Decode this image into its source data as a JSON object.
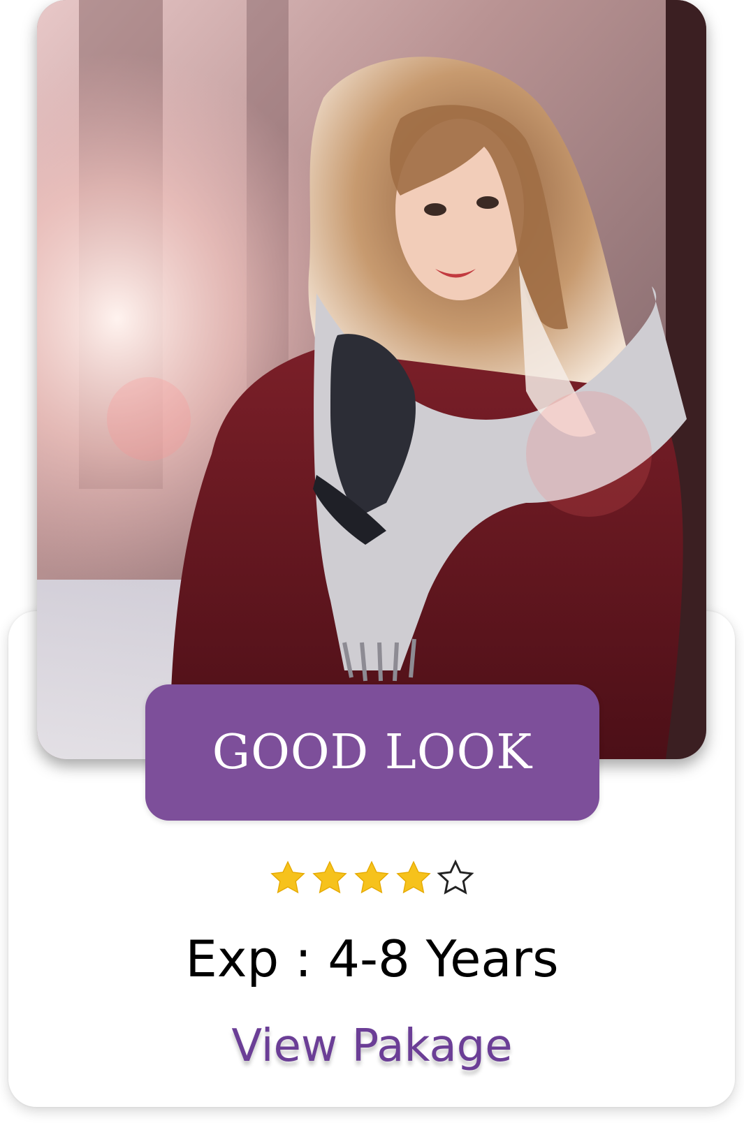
{
  "card": {
    "title": "GOOD LOOK",
    "rating": 4,
    "rating_max": 5,
    "experience": "Exp : 4-8 Years",
    "link_label": "View Pakage"
  },
  "colors": {
    "accent_purple": "#7d4f9a",
    "link_purple": "#6b3e96",
    "star_filled": "#f6c21c",
    "star_empty_outline": "#222222"
  },
  "icons": {
    "star_filled": "star-filled-icon",
    "star_empty": "star-outline-icon"
  }
}
